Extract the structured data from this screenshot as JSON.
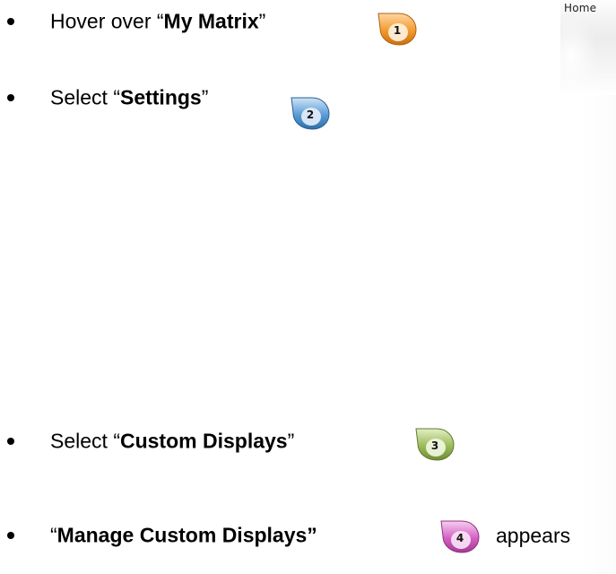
{
  "fragment": {
    "home_label": "Home"
  },
  "steps": [
    {
      "number": "1",
      "prefix": "Hover over  “",
      "bold": "My Matrix",
      "suffix": "”",
      "after": "",
      "marker_color": "#f29a2e"
    },
    {
      "number": "2",
      "prefix": "Select “",
      "bold": "Settings",
      "suffix": "”",
      "after": "",
      "marker_color": "#5b9bd5"
    },
    {
      "number": "3",
      "prefix": "Select “",
      "bold": "Custom Displays",
      "suffix": "”",
      "after": "",
      "marker_color": "#9bbb59"
    },
    {
      "number": "4",
      "prefix": "“",
      "bold": "Manage Custom Displays”",
      "suffix": "",
      "after": "appears",
      "marker_color": "#d45fc4"
    }
  ]
}
